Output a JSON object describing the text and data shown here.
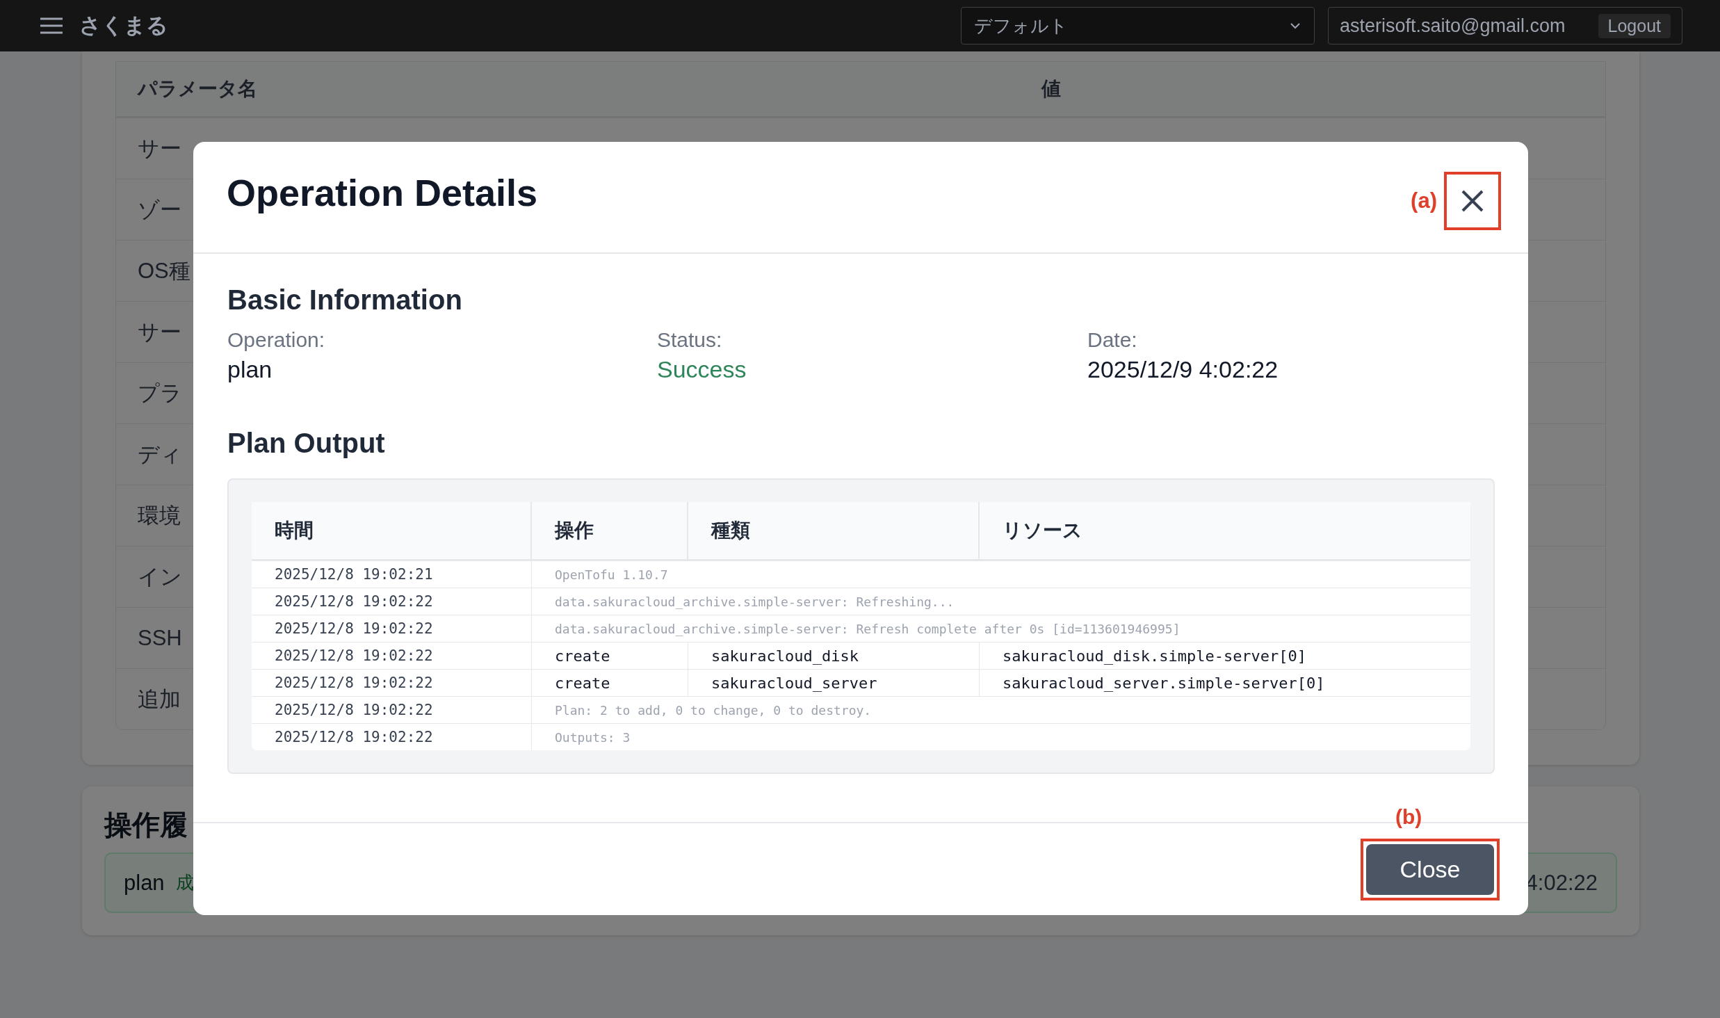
{
  "top_bar": {
    "app_name": "さくまる",
    "profile_select": {
      "value": "デフォルト"
    },
    "user_email": "asterisoft.saito@gmail.com",
    "logout_button": "Logout"
  },
  "background": {
    "parameter_table": {
      "columns": [
        "パラメータ名",
        "値"
      ],
      "rows": [
        "サー",
        "ゾー",
        "OS種",
        "サー",
        "プラ",
        "ディ",
        "環境",
        "イン",
        "SSH",
        "追加"
      ]
    },
    "history": {
      "title": "操作履",
      "items": [
        {
          "operation": "plan",
          "status": "成",
          "date": "4:02:22"
        }
      ]
    }
  },
  "modal": {
    "title": "Operation Details",
    "basic_info": {
      "heading": "Basic Information",
      "fields": [
        {
          "label": "Operation:",
          "value": "plan",
          "kind": "plain"
        },
        {
          "label": "Status:",
          "value": "Success",
          "kind": "success"
        },
        {
          "label": "Date:",
          "value": "2025/12/9 4:02:22",
          "kind": "plain"
        }
      ]
    },
    "plan_output": {
      "heading": "Plan Output",
      "columns": [
        "時間",
        "操作",
        "種類",
        "リソース"
      ],
      "rows": [
        {
          "kind": "message",
          "time": "2025/12/8 19:02:21",
          "message": "OpenTofu 1.10.7"
        },
        {
          "kind": "message",
          "time": "2025/12/8 19:02:22",
          "message": "data.sakuracloud_archive.simple-server: Refreshing..."
        },
        {
          "kind": "message",
          "time": "2025/12/8 19:02:22",
          "message": "data.sakuracloud_archive.simple-server: Refresh complete after 0s [id=113601946995]"
        },
        {
          "kind": "change",
          "time": "2025/12/8 19:02:22",
          "operation": "create",
          "type": "sakuracloud_disk",
          "resource": "sakuracloud_disk.simple-server[0]"
        },
        {
          "kind": "change",
          "time": "2025/12/8 19:02:22",
          "operation": "create",
          "type": "sakuracloud_server",
          "resource": "sakuracloud_server.simple-server[0]"
        },
        {
          "kind": "message",
          "time": "2025/12/8 19:02:22",
          "message": "Plan: 2 to add, 0 to change, 0 to destroy."
        },
        {
          "kind": "message",
          "time": "2025/12/8 19:02:22",
          "message": "Outputs: 3"
        }
      ]
    },
    "close_button": "Close"
  },
  "annotations": {
    "close_icon": "(a)",
    "close_button": "(b)"
  }
}
